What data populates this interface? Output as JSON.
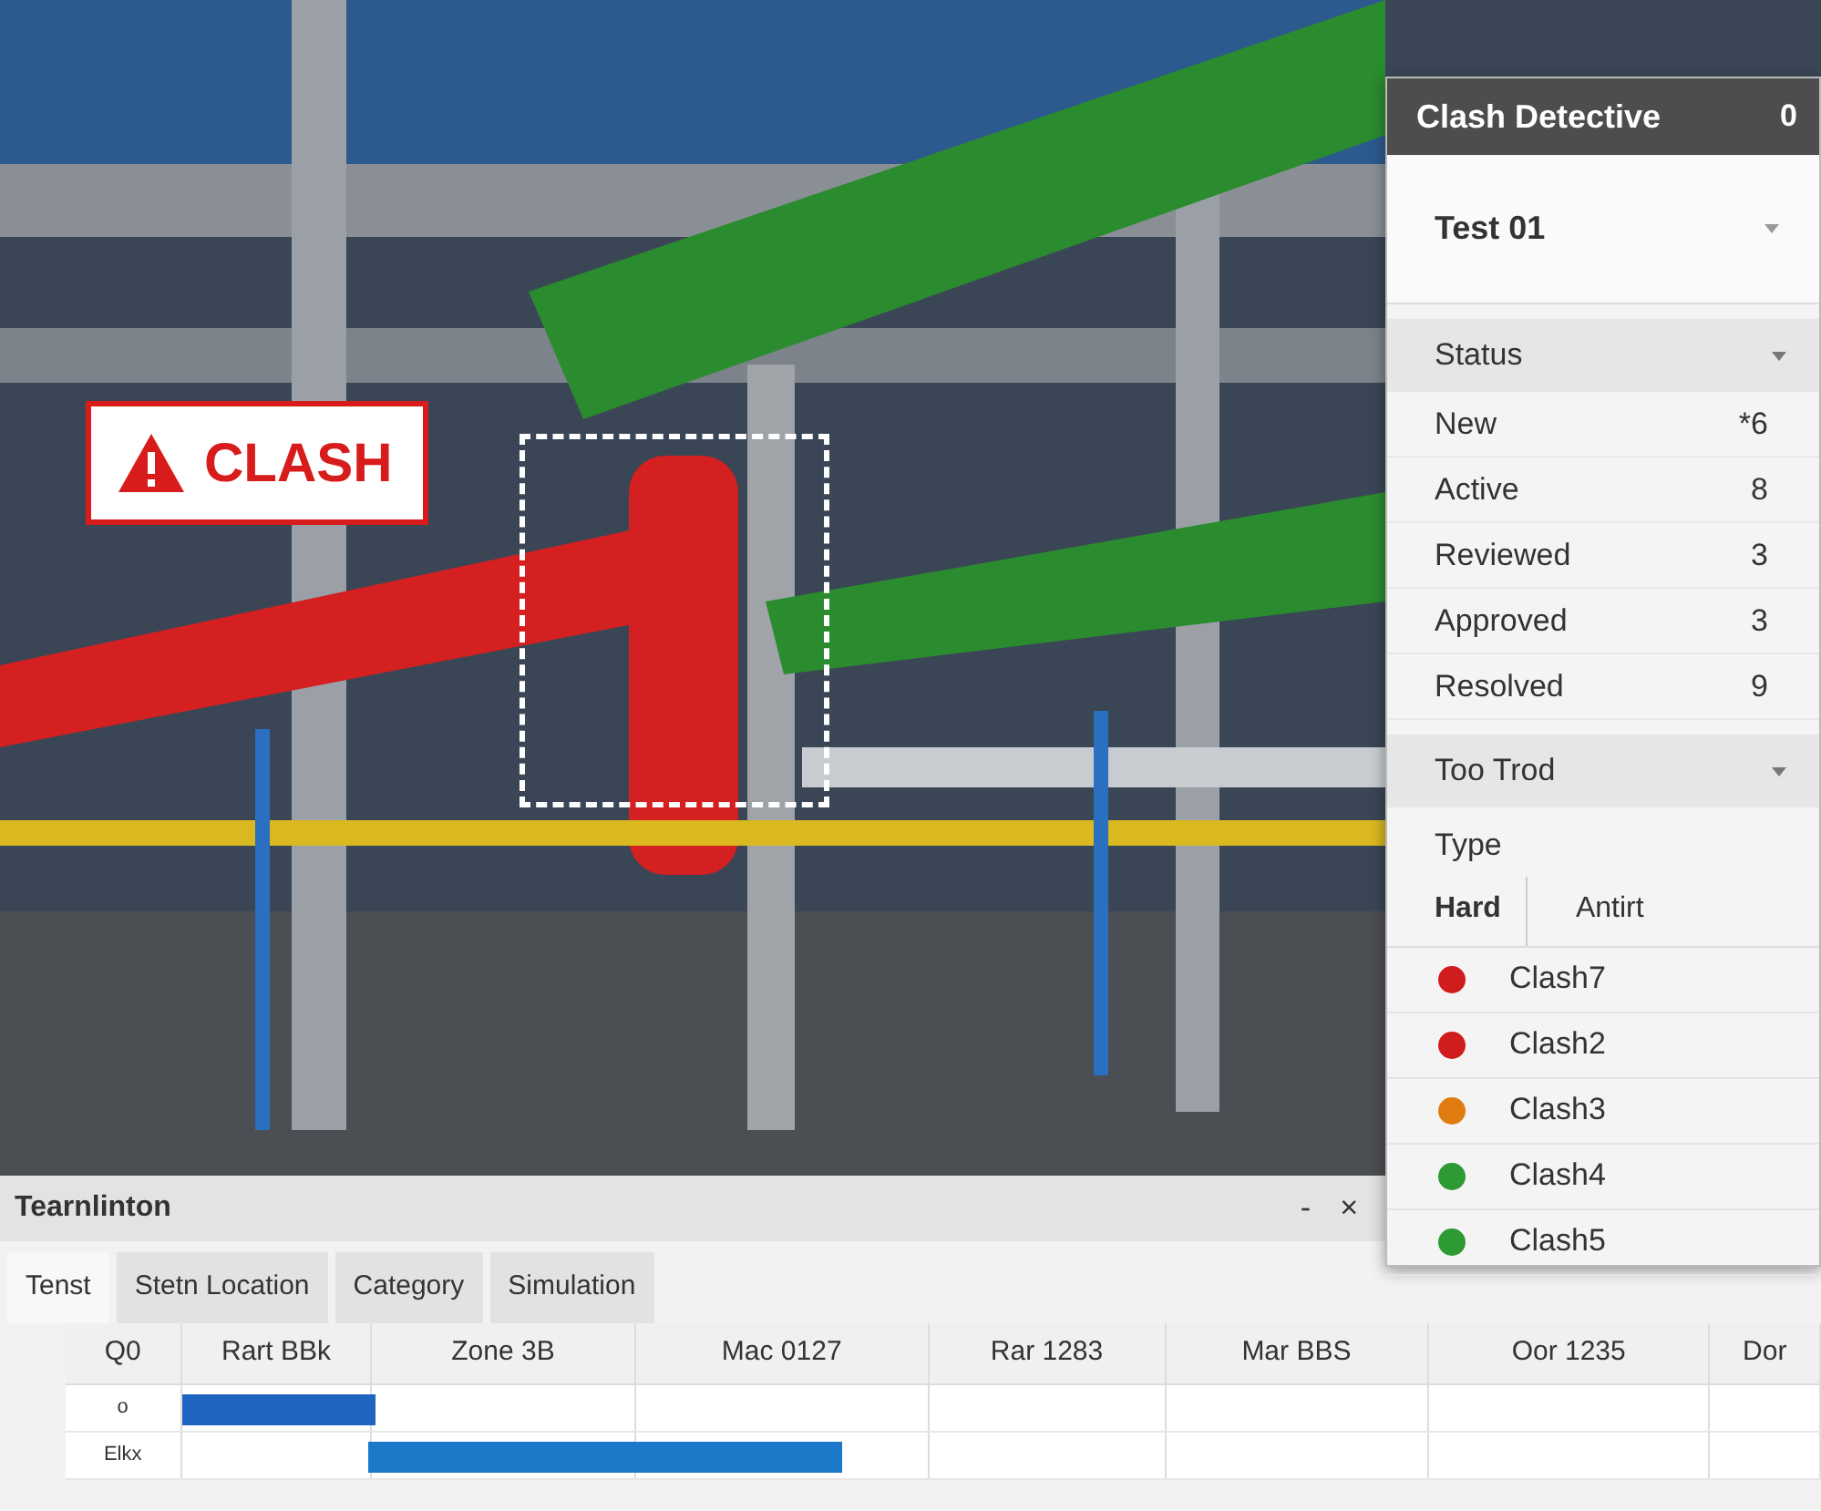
{
  "viewport": {
    "clash_label": {
      "text": "CLASH"
    }
  },
  "clash_panel": {
    "title": "Clash Detective",
    "title_button": "0",
    "test": "Test 01",
    "sections": [
      {
        "title": "Status",
        "expanded": true,
        "rows": [
          {
            "label": "New",
            "count": "*6"
          },
          {
            "label": "Active",
            "count": "8"
          },
          {
            "label": "Reviewed",
            "count": "3"
          },
          {
            "label": "Approved",
            "count": "3"
          },
          {
            "label": "Resolved",
            "count": "9"
          }
        ]
      },
      {
        "title": "Too Trod",
        "expanded": true
      }
    ],
    "type_label": "Type",
    "type_tabs": [
      {
        "label": "Hard",
        "selected": true
      },
      {
        "label": "Antirt",
        "selected": false
      }
    ],
    "clashes": [
      {
        "name": "Clash7",
        "color": "#d01c1c"
      },
      {
        "name": "Clash2",
        "color": "#d01c1c"
      },
      {
        "name": "Clash3",
        "color": "#e07b10"
      },
      {
        "name": "Clash4",
        "color": "#2e9a34"
      },
      {
        "name": "Clash5",
        "color": "#2e9a34"
      }
    ]
  },
  "timeline": {
    "title": "Tearnlinton",
    "buttons": [
      "-",
      "×"
    ],
    "tabs": [
      {
        "label": "Tenst",
        "selected": true
      },
      {
        "label": "Stetn Location",
        "selected": false
      },
      {
        "label": "Category",
        "selected": false
      },
      {
        "label": "Simulation",
        "selected": false
      }
    ],
    "columns": [
      "Q0",
      "Rart BBk",
      "Zone 3B",
      "Mac 0127",
      "Rar 1283",
      "Mar BBS",
      "Oor 1235",
      "Dor"
    ],
    "rows": [
      {
        "label": "o"
      },
      {
        "label": "Elkx"
      }
    ]
  }
}
